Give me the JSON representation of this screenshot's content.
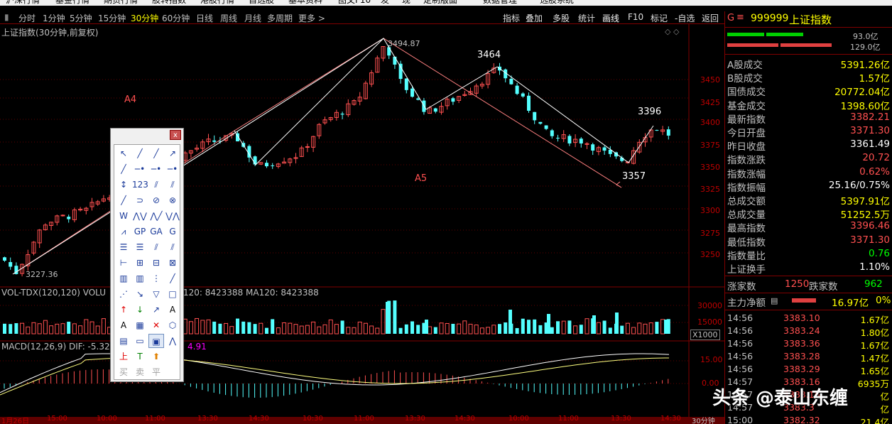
{
  "menubar": {
    "items": [
      "沪深行情",
      "基金行情",
      "期货行情",
      "股转指数",
      "港股行情",
      "自选股",
      "基本资料",
      "图文F10",
      "发",
      "现",
      "定制版面",
      "数据管理",
      "选股系统"
    ]
  },
  "periods": [
    "分时",
    "1分钟",
    "5分钟",
    "15分钟",
    "30分钟",
    "60分钟",
    "日线",
    "周线",
    "月线",
    "多周期",
    "更多 >"
  ],
  "active_period": "30分钟",
  "right_tools": [
    "指标",
    "叠加",
    "多股",
    "统计",
    "画线",
    "F10",
    "标记",
    "-自选",
    "返回"
  ],
  "chart": {
    "title": "上证指数(30分钟,前复权)",
    "price_axis": [
      "3450",
      "3425",
      "3400",
      "3375",
      "3350",
      "3325",
      "3300",
      "3275",
      "3250"
    ],
    "labels": {
      "high": "3494.87",
      "low": "3227.36",
      "p3464": "3464",
      "p3396": "3396",
      "p3357": "3357",
      "a4": "A4",
      "a5": "A5"
    },
    "vol_title": "VOL-TDX(120,120)  VOLU",
    "vol_ma": "120: 8423388  MA120: 8423388",
    "vol_axis": [
      "30000",
      "15000"
    ],
    "vol_unit": "X1000",
    "macd_title": "MACD(12,26,9)  DIF: -5.32",
    "macd_val": "4.91",
    "macd_axis": [
      "15.00",
      "0.00"
    ],
    "time_axis": [
      "1月26日",
      "15:00",
      "10:00",
      "11:00",
      "13:30",
      "14:30",
      "10:30",
      "11:00",
      "13:30",
      "14:30",
      "10:00",
      "11:00",
      "13:30",
      "14:30"
    ],
    "period_tag": "30分钟"
  },
  "chart_data": {
    "type": "candlestick",
    "title": "上证指数(30分钟,前复权)",
    "ylim": [
      3227.36,
      3494.87
    ],
    "annotated_points": [
      {
        "label": "3227.36",
        "y": 3227.36
      },
      {
        "label": "3494.87",
        "y": 3494.87
      },
      {
        "label": "3464",
        "y": 3464
      },
      {
        "label": "3357",
        "y": 3357
      },
      {
        "label": "3396",
        "y": 3396
      }
    ],
    "wave_labels": [
      "A4",
      "A5"
    ]
  },
  "quote": {
    "code": "999999",
    "name": "上证指数",
    "flag": "G",
    "bar1": "93.0亿",
    "bar2": "129.0亿",
    "rows": [
      {
        "k": "A股成交",
        "v": "5391.26亿",
        "c": "yel"
      },
      {
        "k": "B股成交",
        "v": "1.57亿",
        "c": "yel"
      },
      {
        "k": "国债成交",
        "v": "20772.04亿",
        "c": "yel"
      },
      {
        "k": "基金成交",
        "v": "1398.60亿",
        "c": "yel"
      },
      {
        "k": "最新指数",
        "v": "3382.21",
        "c": "red"
      },
      {
        "k": "今日开盘",
        "v": "3371.30",
        "c": "red"
      },
      {
        "k": "昨日收盘",
        "v": "3361.49",
        "c": "wht"
      },
      {
        "k": "指数涨跌",
        "v": "20.72",
        "c": "red"
      },
      {
        "k": "指数涨幅",
        "v": "0.62%",
        "c": "red"
      },
      {
        "k": "指数振幅",
        "v": "25.16/0.75%",
        "c": "wht"
      },
      {
        "k": "总成交额",
        "v": "5397.91亿",
        "c": "yel"
      },
      {
        "k": "总成交量",
        "v": "51252.5万",
        "c": "yel"
      },
      {
        "k": "最高指数",
        "v": "3396.46",
        "c": "red"
      },
      {
        "k": "最低指数",
        "v": "3371.30",
        "c": "red"
      },
      {
        "k": "指数量比",
        "v": "0.76",
        "c": "grn"
      },
      {
        "k": "上证换手",
        "v": "1.10%",
        "c": "wht"
      }
    ],
    "up_label": "涨家数",
    "up": "1250",
    "down_label": "跌家数",
    "down": "962",
    "net_label": "主力净额",
    "net": "16.97亿",
    "net_pct": "0%",
    "ticks": [
      {
        "t": "14:56",
        "p": "3383.10",
        "v": "1.67亿"
      },
      {
        "t": "14:56",
        "p": "3383.24",
        "v": "1.80亿"
      },
      {
        "t": "14:56",
        "p": "3383.36",
        "v": "1.67亿"
      },
      {
        "t": "14:56",
        "p": "3383.28",
        "v": "1.47亿"
      },
      {
        "t": "14:56",
        "p": "3383.29",
        "v": "1.65亿"
      },
      {
        "t": "14:57",
        "p": "3383.16",
        "v": "6935万"
      },
      {
        "t": "14:57",
        "p": "3383.16",
        "v": "亿"
      },
      {
        "t": "14:57",
        "p": "3383.3",
        "v": "亿"
      },
      {
        "t": "15:00",
        "p": "3382.32",
        "v": "21.4亿"
      }
    ]
  },
  "toolbox": {
    "close": "x",
    "bottom": [
      "买",
      "卖",
      "平"
    ]
  },
  "watermark": "头条 @泰山东缠"
}
